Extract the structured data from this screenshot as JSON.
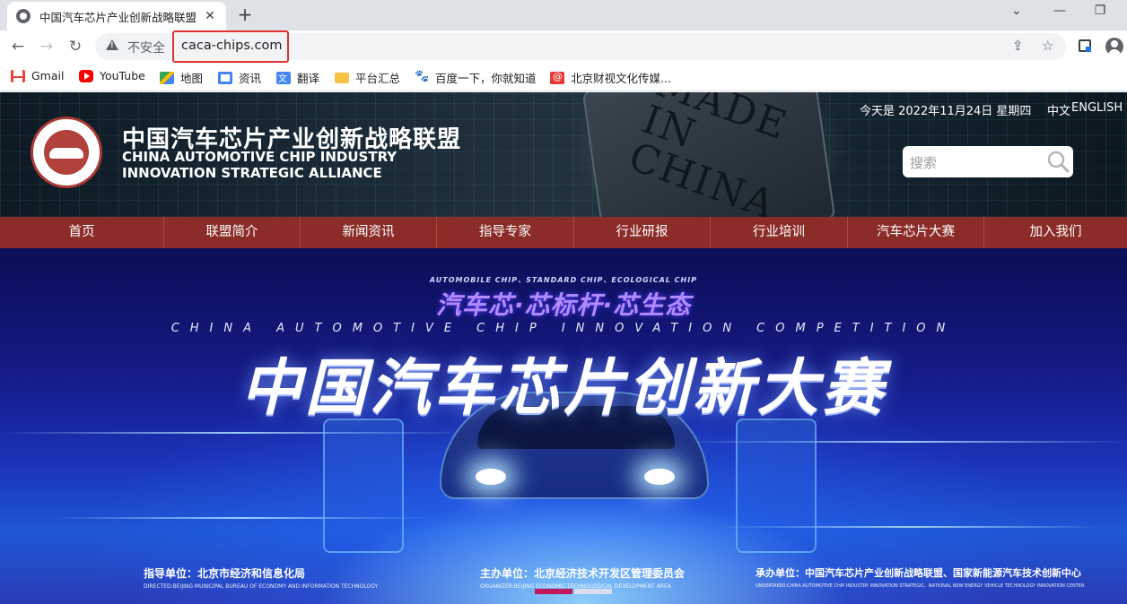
{
  "browser": {
    "tab_title": "中国汽车芯片产业创新战略联盟",
    "security_label": "不安全",
    "url": "caca-chips.com",
    "bookmarks": [
      {
        "label": "Gmail",
        "icon": "gmail-icon"
      },
      {
        "label": "YouTube",
        "icon": "youtube-icon"
      },
      {
        "label": "地图",
        "icon": "maps-icon"
      },
      {
        "label": "资讯",
        "icon": "news-icon"
      },
      {
        "label": "翻译",
        "icon": "translate-icon"
      },
      {
        "label": "平台汇总",
        "icon": "folder-icon"
      },
      {
        "label": "百度一下，你就知道",
        "icon": "baidu-icon"
      },
      {
        "label": "北京财视文化传媒...",
        "icon": "beijing-media-icon"
      }
    ]
  },
  "site": {
    "org_name_cn": "中国汽车芯片产业创新战略联盟",
    "org_name_en": "CHINA AUTOMOTIVE CHIP INDUSTRY INNOVATION STRATEGIC ALLIANCE",
    "chip_text": "MADE IN CHINA",
    "date_text": "今天是 2022年11月24日 星期四",
    "lang_cn": "中文",
    "lang_en": "ENGLISH",
    "search_placeholder": "搜索",
    "nav": [
      "首页",
      "联盟简介",
      "新闻资讯",
      "指导专家",
      "行业研报",
      "行业培训",
      "汽车芯片大赛",
      "加入我们"
    ],
    "banner": {
      "slogan_en": "AUTOMOBILE CHIP、STANDARD CHIP、ECOLOGICAL CHIP",
      "slogan_cn": "汽车芯·芯标杆·芯生态",
      "competition_en": "CHINA AUTOMOTIVE CHIP INNOVATION COMPETITION",
      "competition_cn": "中国汽车芯片创新大赛",
      "directed_cn": "指导单位：北京市经济和信息化局",
      "directed_en": "DIRECTED:BEIJING MUNICIPAL BUREAU OF ECONOMY AND INFORMATION TECHNOLOGY",
      "organizer_cn": "主办单位：北京经济技术开发区管理委员会",
      "organizer_en": "ORGANIZER:BEIJING ECONOMIC-TECHNOLOGICAL DEVELOPMENT AREA",
      "undertaker_cn": "承办单位：中国汽车芯片产业创新战略联盟、国家新能源汽车技术创新中心",
      "undertaker_en": "UNDERTAKER:CHINA AUTOMOTIVE CHIP INDUSTRY INNOVATION STRATEGIC、NATIONAL NEW ENERGY VEHICLE TECHNOLOGY INNOVATION CENTER"
    }
  },
  "colors": {
    "nav_bg": "#8b2c28",
    "url_highlight": "#e03030",
    "tabstrip_bg": "#dee1e6"
  }
}
